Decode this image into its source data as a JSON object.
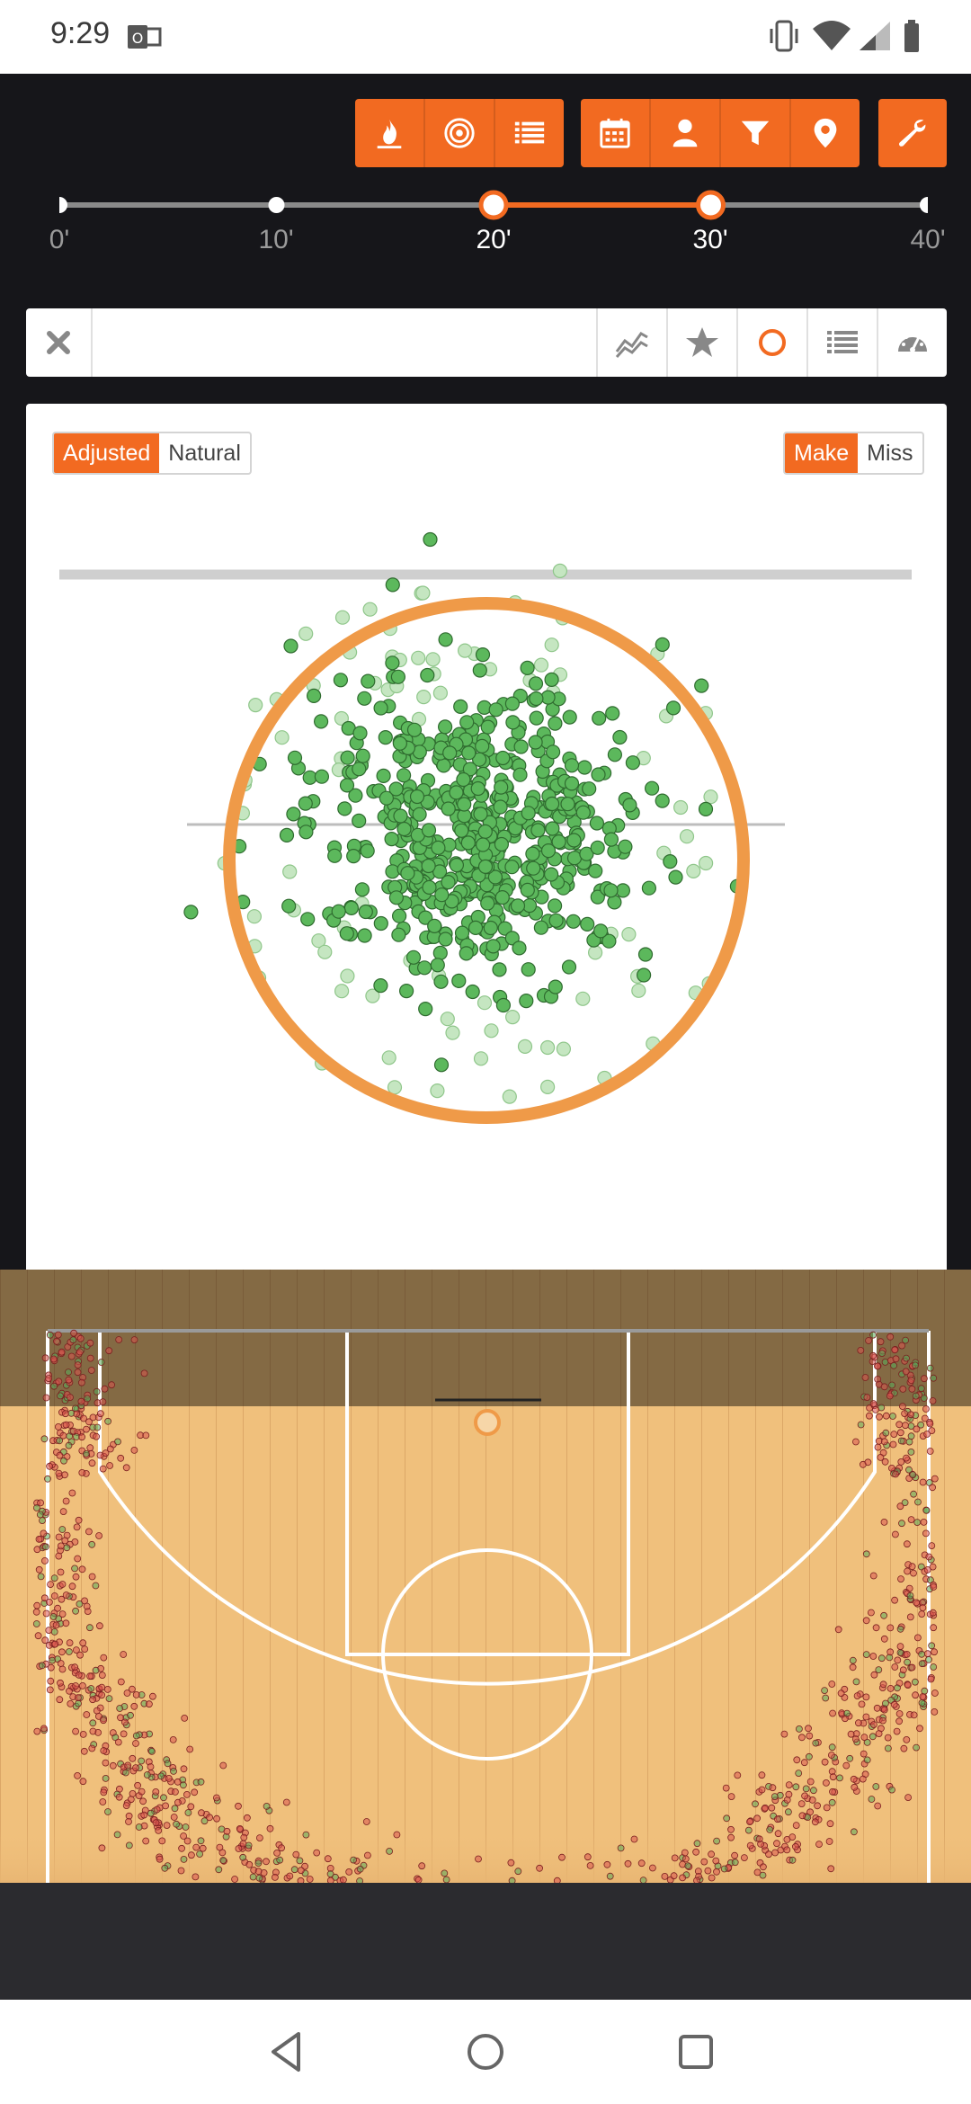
{
  "status_bar": {
    "time": "9:29"
  },
  "toolbar": {
    "groups": [
      [
        "flame-icon",
        "target-icon",
        "list-icon"
      ],
      [
        "calendar-icon",
        "person-icon",
        "filter-icon",
        "location-pin-icon"
      ],
      [
        "wrench-icon"
      ]
    ],
    "accent": "#f26a21"
  },
  "distance_slider": {
    "ticks": [
      "0'",
      "10'",
      "20'",
      "30'",
      "40'"
    ],
    "range_start": "20'",
    "range_end": "30'",
    "min": 0,
    "max": 40,
    "selected_min": 20,
    "selected_max": 30
  },
  "search_bar": {
    "query": "",
    "view_tabs": [
      "trend-line-icon",
      "star-icon",
      "circle-icon",
      "list-icon",
      "gauge-icon"
    ],
    "active_tab": "circle-icon"
  },
  "panel": {
    "mode_toggle": {
      "options": [
        "Adjusted",
        "Natural"
      ],
      "selected": "Adjusted"
    },
    "result_toggle": {
      "options": [
        "Make",
        "Miss"
      ],
      "selected": "Make"
    }
  },
  "chart_data": {
    "type": "scatter",
    "description_free": true,
    "rim_color": "#ef9a48",
    "point_color_make": "#5cb85c",
    "point_color_faded": "#c5e6c1",
    "center": [
      0,
      0
    ],
    "points_solid_count_approx": 560,
    "points_faded_count_approx": 90,
    "spread_x": 0.32,
    "spread_y": 0.28
  },
  "court": {
    "make_color": "#59a85a",
    "miss_color": "#d9534f",
    "floor_color": "#f0c07c"
  }
}
